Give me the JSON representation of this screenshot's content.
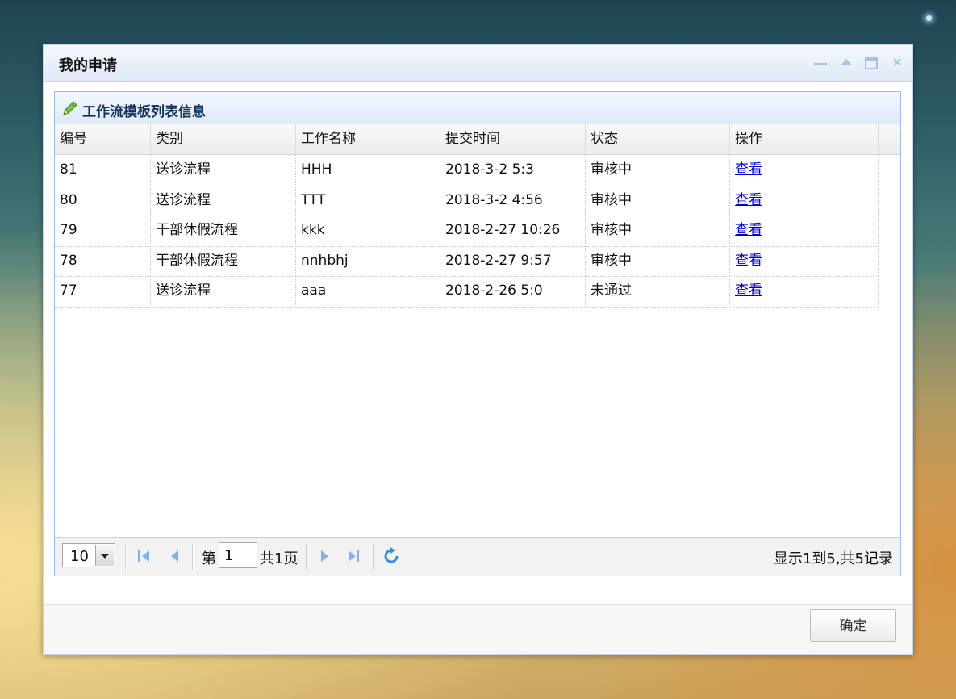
{
  "window": {
    "title": "我的申请",
    "controls": [
      "minimize-icon",
      "collapse-icon",
      "maximize-icon",
      "close-icon"
    ],
    "close_glyph": "×"
  },
  "panel": {
    "title": "工作流模板列表信息",
    "icon": "pencil-icon"
  },
  "grid": {
    "columns": [
      "编号",
      "类别",
      "工作名称",
      "提交时间",
      "状态",
      "操作"
    ],
    "rows": [
      [
        "81",
        "送诊流程",
        "HHH",
        "2018-3-2 5:3",
        "审核中",
        "查看"
      ],
      [
        "80",
        "送诊流程",
        "TTT",
        "2018-3-2 4:56",
        "审核中",
        "查看"
      ],
      [
        "79",
        "干部休假流程",
        "kkk",
        "2018-2-27 10:26",
        "审核中",
        "查看"
      ],
      [
        "78",
        "干部休假流程",
        "nnhbhj",
        "2018-2-27 9:57",
        "审核中",
        "查看"
      ],
      [
        "77",
        "送诊流程",
        "aaa",
        "2018-2-26 5:0",
        "未通过",
        "查看"
      ]
    ]
  },
  "pager": {
    "page_size": "10",
    "page_prefix": "第",
    "page_value": "1",
    "page_total": "共1页",
    "info": "显示1到5,共5记录"
  },
  "footer": {
    "ok_label": "确定"
  },
  "colors": {
    "link": "#0000cc",
    "panel_border": "#99bbe8",
    "pager_icon": "#7fb3e6"
  }
}
